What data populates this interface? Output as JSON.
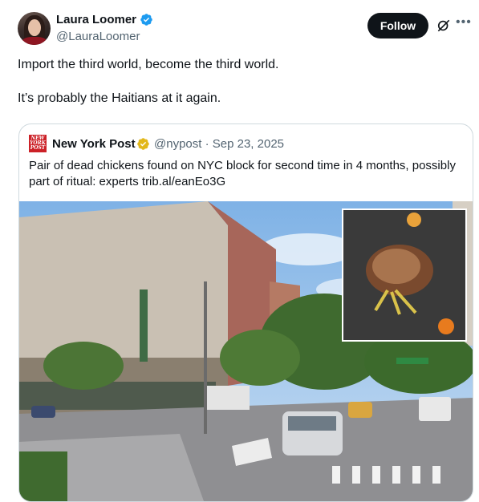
{
  "author": {
    "display_name": "Laura Loomer",
    "handle": "@LauraLoomer"
  },
  "actions": {
    "follow_label": "Follow",
    "grok_icon": "grok-icon",
    "more_icon": "more-icon"
  },
  "tweet": {
    "paragraphs": [
      "Import the third world, become the third world.",
      "It’s probably the Haitians at it again."
    ]
  },
  "quote": {
    "logo_text": "NEW YORK POST",
    "display_name": "New York Post",
    "handle": "@nypost",
    "separator": "·",
    "date": "Sep 23, 2025",
    "text": "Pair of dead chickens found on NYC block for second time in 4 months, possibly part of ritual: experts trib.al/eanEo3G"
  },
  "colors": {
    "verified_blue": "#1d9bf0",
    "verified_gold": "#e2b719",
    "nypost_red": "#cc2127",
    "follow_bg": "#0f1419"
  }
}
